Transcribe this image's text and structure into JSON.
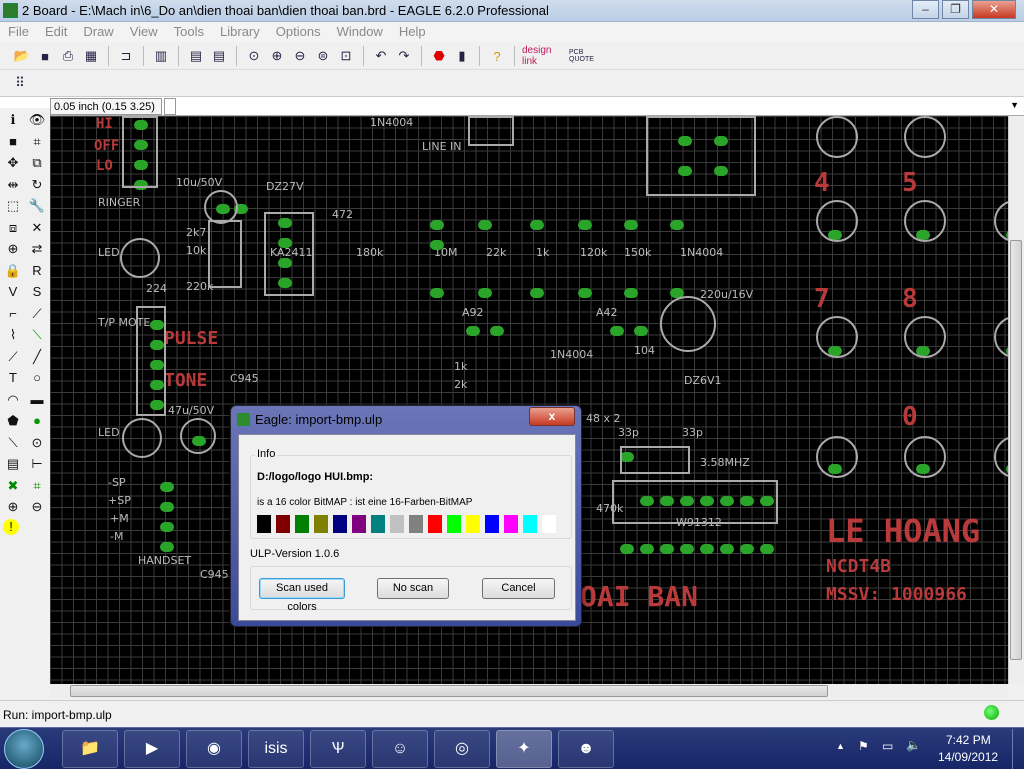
{
  "window": {
    "title": "2 Board - E:\\Mach in\\6_Do an\\dien thoai ban\\dien thoai ban.brd - EAGLE 6.2.0 Professional",
    "controls": [
      "minimize",
      "restore",
      "close"
    ]
  },
  "menu": [
    "File",
    "Edit",
    "Draw",
    "View",
    "Tools",
    "Library",
    "Options",
    "Window",
    "Help"
  ],
  "toolbar": {
    "icons": [
      "open-icon",
      "save-icon",
      "print-icon",
      "cam-icon",
      "|",
      "schematic-icon",
      "|",
      "library-icon",
      "|",
      "script-icon",
      "ulp-icon",
      "|",
      "zoom-fit-icon",
      "zoom-in-icon",
      "zoom-out-icon",
      "zoom-redraw-icon",
      "zoom-select-icon",
      "|",
      "undo-icon",
      "redo-icon",
      "|",
      "stop-icon",
      "go-icon",
      "|",
      "help-icon",
      "|"
    ],
    "designlink": "design link",
    "pcbquote": "PCB QUOTE"
  },
  "coord": {
    "value": "0.05 inch (0.15 3.25)"
  },
  "left_tools": [
    "info",
    "show",
    "display",
    "mark",
    "move",
    "copy",
    "mirror",
    "rotate",
    "group",
    "change",
    "paste",
    "delete",
    "add",
    "replace",
    "lock",
    "name",
    "value",
    "smash",
    "miter",
    "split",
    "optimize",
    "route",
    "ripup",
    "wire",
    "text",
    "circle",
    "arc",
    "rect",
    "polygon",
    "via",
    "signal",
    "hole",
    "attribute",
    "dimension",
    "ratsnest",
    "auto",
    "erc",
    "drc",
    "errors"
  ],
  "pcb": {
    "labels_red": [
      "HI",
      "OFF",
      "LO",
      "PULSE",
      "TONE",
      "4",
      "5",
      "7",
      "8",
      "0",
      "LE HOANG",
      "NCDT4B",
      "MSSV: 1000966",
      "OAI BAN"
    ],
    "labels_white": [
      "RINGER",
      "LED",
      "T/P MOTE",
      "LED",
      "-SP",
      "+SP",
      "+M",
      "-M",
      "HANDSET",
      "10u/50V",
      "DZ27V",
      "2k7",
      "10k",
      "220k",
      "224",
      "1N4004",
      "472",
      "180k",
      "LINE IN",
      "10M",
      "22k",
      "1k",
      "120k",
      "150k",
      "1N4004",
      "220u/16V",
      "A92",
      "A42",
      "1k",
      "2k",
      "C945",
      "47u/50V",
      "1N4004",
      "104",
      "DZ6V1",
      "48 x 2",
      "33p",
      "33p",
      "3.58MHZ",
      "470k",
      "W91312",
      "C945",
      "KA2411"
    ]
  },
  "dialog": {
    "title": "Eagle: import-bmp.ulp",
    "close": "x",
    "group_label": "Info",
    "file": "D:/logo/logo HUI.bmp:",
    "desc": "is a 16 color BitMAP : ist eine 16-Farben-BitMAP",
    "colors": [
      "#000000",
      "#800000",
      "#008000",
      "#808000",
      "#000080",
      "#800080",
      "#008080",
      "#c0c0c0",
      "#808080",
      "#ff0000",
      "#00ff00",
      "#ffff00",
      "#0000ff",
      "#ff00ff",
      "#00ffff",
      "#ffffff"
    ],
    "version": "ULP-Version 1.0.6",
    "buttons": {
      "scan": "Scan used colors",
      "noscan": "No scan",
      "cancel": "Cancel"
    }
  },
  "status": {
    "text": "Run: import-bmp.ulp"
  },
  "taskbar": {
    "apps": [
      "explorer",
      "media-player",
      "chrome",
      "isis",
      "eagle-ulp",
      "messenger",
      "network",
      "eagle",
      "yahoo-messenger"
    ],
    "time": "7:42 PM",
    "date": "14/09/2012"
  }
}
